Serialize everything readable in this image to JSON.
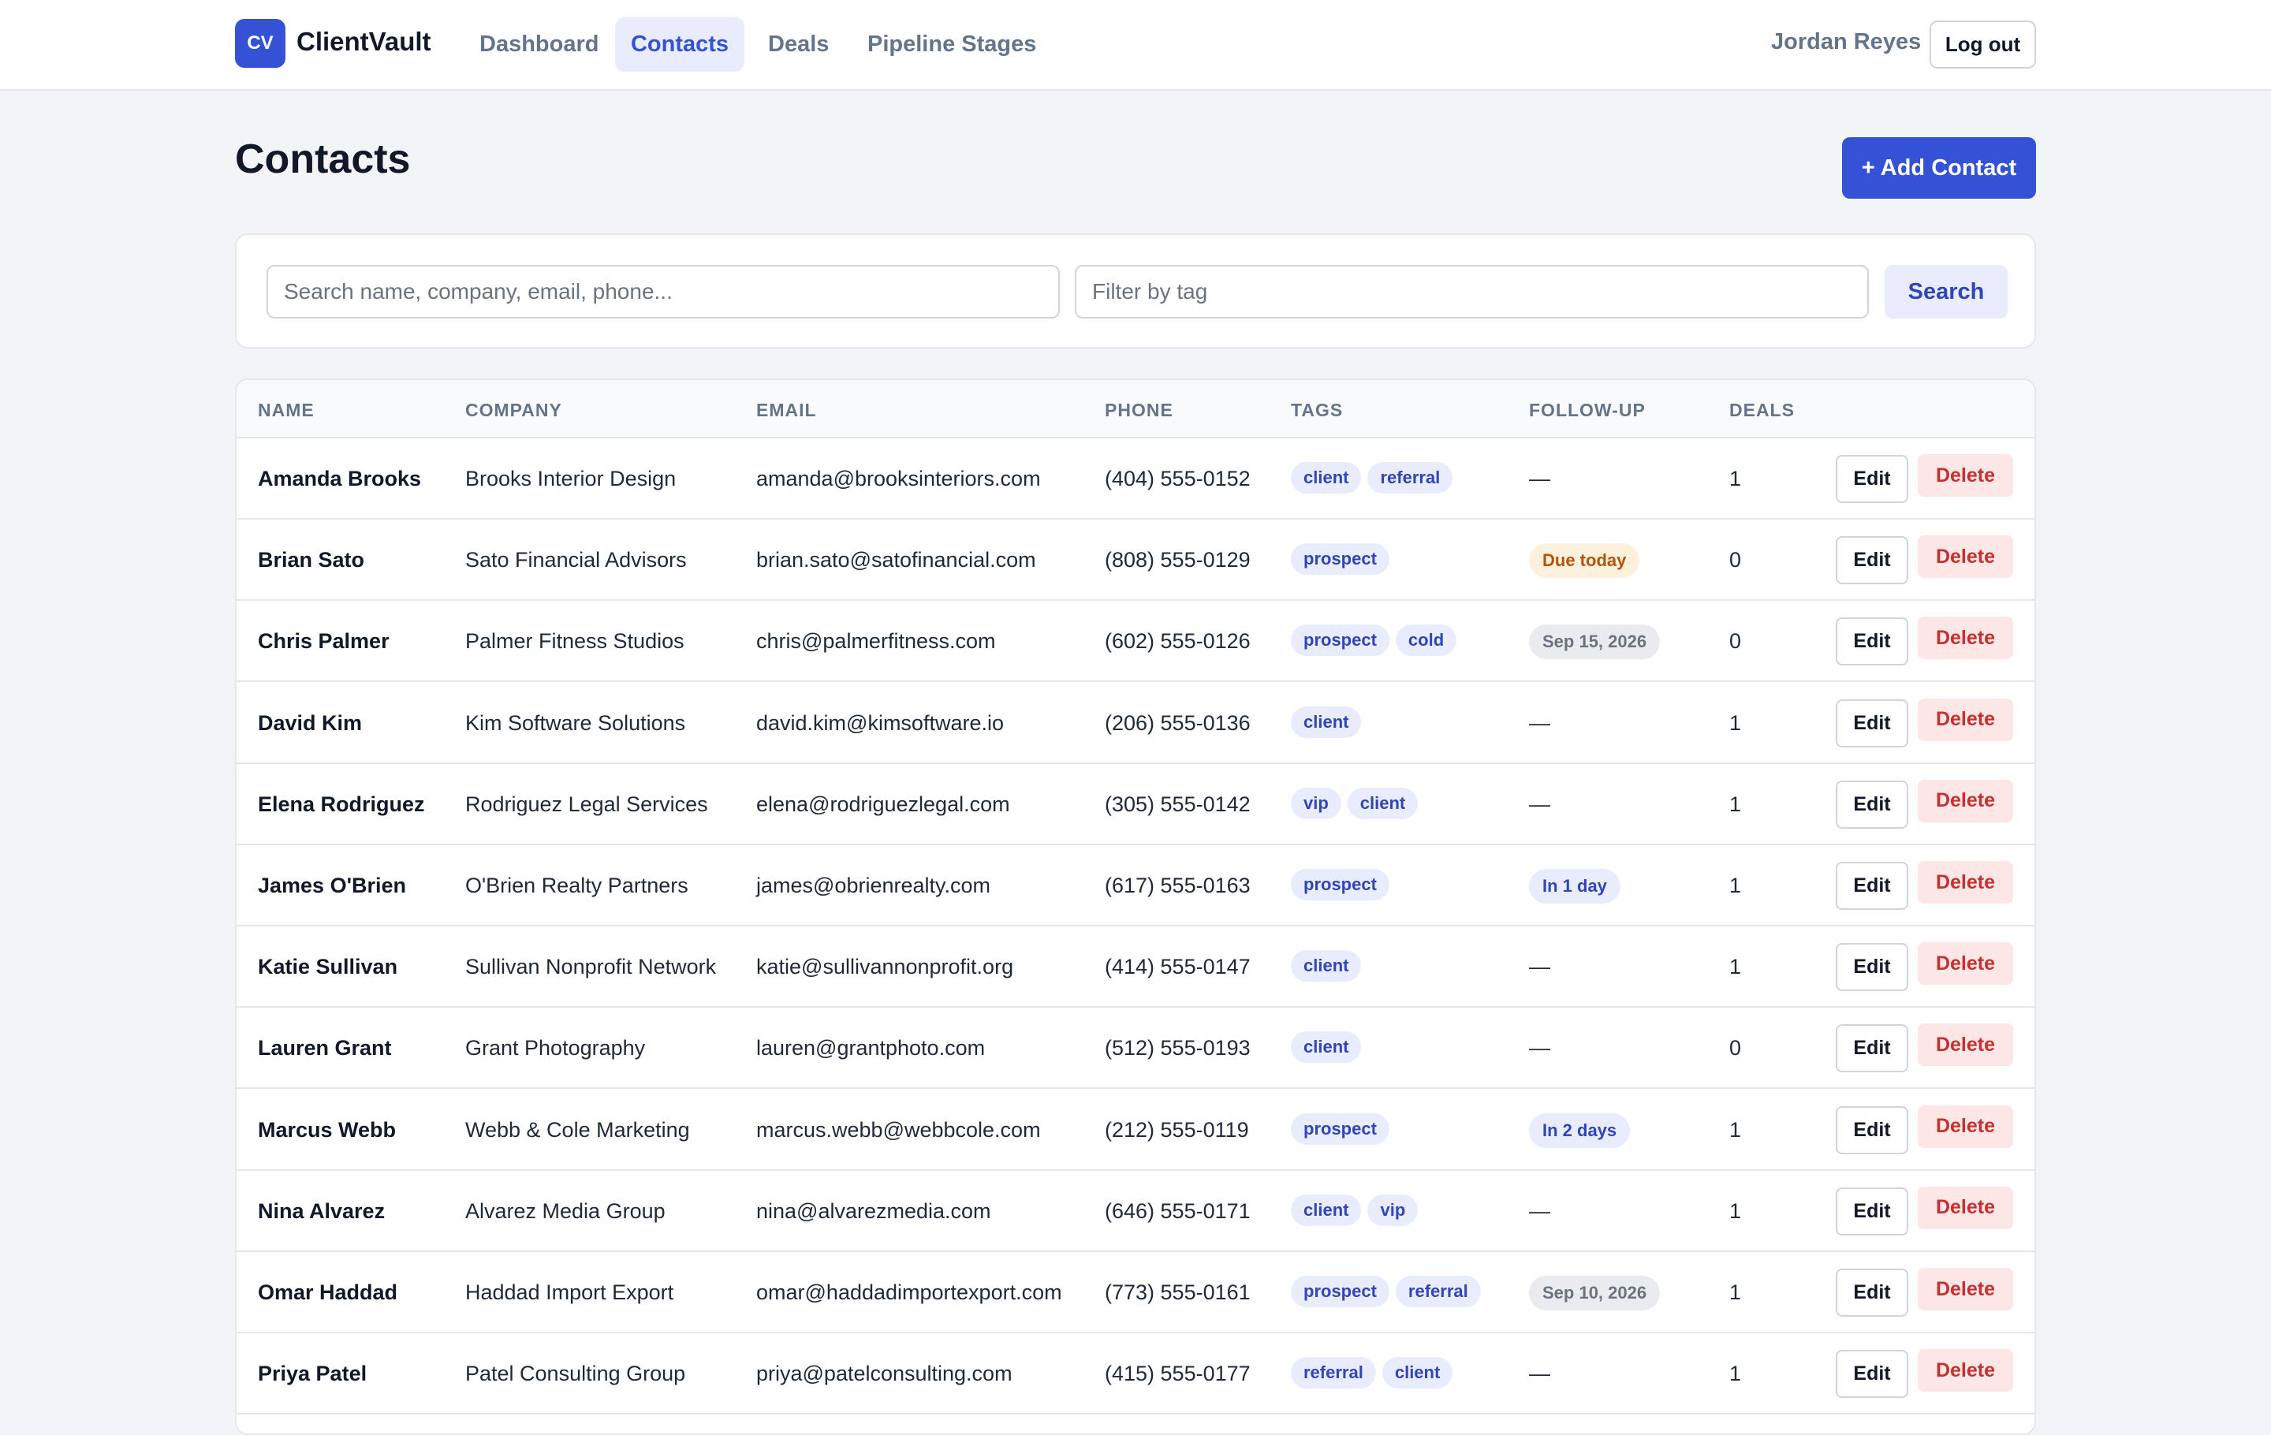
{
  "app": {
    "logo_initials": "CV",
    "name": "ClientVault"
  },
  "nav": {
    "items": [
      {
        "label": "Dashboard",
        "active": false
      },
      {
        "label": "Contacts",
        "active": true
      },
      {
        "label": "Deals",
        "active": false
      },
      {
        "label": "Pipeline Stages",
        "active": false
      }
    ]
  },
  "user": {
    "name": "Jordan Reyes",
    "logout_label": "Log out"
  },
  "page": {
    "title": "Contacts",
    "add_button": "+ Add Contact"
  },
  "search": {
    "query_placeholder": "Search name, company, email, phone...",
    "tag_placeholder": "Filter by tag",
    "button_label": "Search"
  },
  "table": {
    "columns": [
      "NAME",
      "COMPANY",
      "EMAIL",
      "PHONE",
      "TAGS",
      "FOLLOW-UP",
      "DEALS"
    ],
    "edit_label": "Edit",
    "delete_label": "Delete",
    "rows": [
      {
        "name": "Amanda Brooks",
        "company": "Brooks Interior Design",
        "email": "amanda@brooksinteriors.com",
        "phone": "(404) 555-0152",
        "tags": [
          "client",
          "referral"
        ],
        "followup": "—",
        "followup_type": "none",
        "deals": "1"
      },
      {
        "name": "Brian Sato",
        "company": "Sato Financial Advisors",
        "email": "brian.sato@satofinancial.com",
        "phone": "(808) 555-0129",
        "tags": [
          "prospect"
        ],
        "followup": "Due today",
        "followup_type": "warn",
        "deals": "0"
      },
      {
        "name": "Chris Palmer",
        "company": "Palmer Fitness Studios",
        "email": "chris@palmerfitness.com",
        "phone": "(602) 555-0126",
        "tags": [
          "prospect",
          "cold"
        ],
        "followup": "Sep 15, 2026",
        "followup_type": "date",
        "deals": "0"
      },
      {
        "name": "David Kim",
        "company": "Kim Software Solutions",
        "email": "david.kim@kimsoftware.io",
        "phone": "(206) 555-0136",
        "tags": [
          "client"
        ],
        "followup": "—",
        "followup_type": "none",
        "deals": "1"
      },
      {
        "name": "Elena Rodriguez",
        "company": "Rodriguez Legal Services",
        "email": "elena@rodriguezlegal.com",
        "phone": "(305) 555-0142",
        "tags": [
          "vip",
          "client"
        ],
        "followup": "—",
        "followup_type": "none",
        "deals": "1"
      },
      {
        "name": "James O'Brien",
        "company": "O'Brien Realty Partners",
        "email": "james@obrienrealty.com",
        "phone": "(617) 555-0163",
        "tags": [
          "prospect"
        ],
        "followup": "In 1 day",
        "followup_type": "soon",
        "deals": "1"
      },
      {
        "name": "Katie Sullivan",
        "company": "Sullivan Nonprofit Network",
        "email": "katie@sullivannonprofit.org",
        "phone": "(414) 555-0147",
        "tags": [
          "client"
        ],
        "followup": "—",
        "followup_type": "none",
        "deals": "1"
      },
      {
        "name": "Lauren Grant",
        "company": "Grant Photography",
        "email": "lauren@grantphoto.com",
        "phone": "(512) 555-0193",
        "tags": [
          "client"
        ],
        "followup": "—",
        "followup_type": "none",
        "deals": "0"
      },
      {
        "name": "Marcus Webb",
        "company": "Webb & Cole Marketing",
        "email": "marcus.webb@webbcole.com",
        "phone": "(212) 555-0119",
        "tags": [
          "prospect"
        ],
        "followup": "In 2 days",
        "followup_type": "soon",
        "deals": "1"
      },
      {
        "name": "Nina Alvarez",
        "company": "Alvarez Media Group",
        "email": "nina@alvarezmedia.com",
        "phone": "(646) 555-0171",
        "tags": [
          "client",
          "vip"
        ],
        "followup": "—",
        "followup_type": "none",
        "deals": "1"
      },
      {
        "name": "Omar Haddad",
        "company": "Haddad Import Export",
        "email": "omar@haddadimportexport.com",
        "phone": "(773) 555-0161",
        "tags": [
          "prospect",
          "referral"
        ],
        "followup": "Sep 10, 2026",
        "followup_type": "date",
        "deals": "1"
      },
      {
        "name": "Priya Patel",
        "company": "Patel Consulting Group",
        "email": "priya@patelconsulting.com",
        "phone": "(415) 555-0177",
        "tags": [
          "referral",
          "client"
        ],
        "followup": "—",
        "followup_type": "none",
        "deals": "1"
      }
    ]
  },
  "colors": {
    "accent": "#3552d6",
    "tag_bg": "#e8ecfc",
    "warn_bg": "#fcf1dc",
    "danger": "#c53030"
  }
}
